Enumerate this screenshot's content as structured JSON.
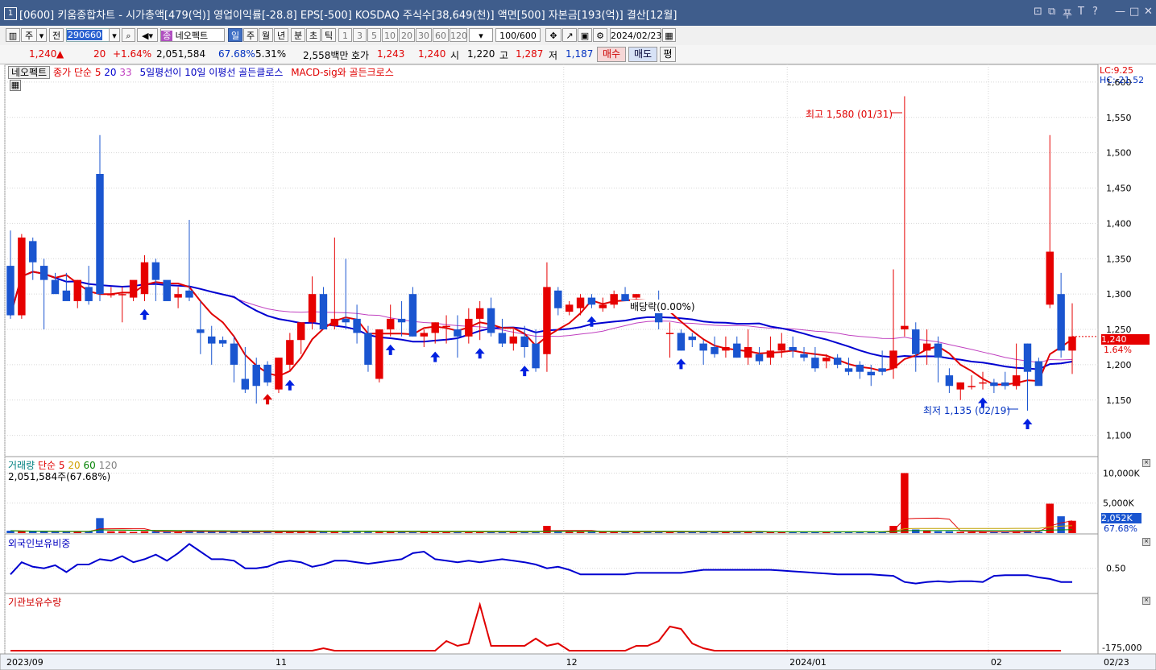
{
  "titlebar": {
    "app_number": "1",
    "title": "[0600] 키움종합차트 - 시가총액[479(억)] 영업이익률[-28.8] EPS[-500] KOSDAQ 주식수[38,649(천)] 액면[500] 자본금[193(억)] 결산[12월]",
    "controls": [
      "⊡",
      "⧉",
      "푸",
      "T",
      "?",
      "—",
      "□",
      "✕"
    ]
  },
  "toolbar": {
    "period_type": "주",
    "scope": "전",
    "code": "290660",
    "stock_name": "네오펙트",
    "stock_badge": "종",
    "periods": [
      "일",
      "주",
      "월",
      "년",
      "분",
      "초",
      "틱"
    ],
    "active_period": "일",
    "intervals": [
      "1",
      "3",
      "5",
      "10",
      "20",
      "30",
      "60",
      "120"
    ],
    "count": "100",
    "count_max": "/600",
    "date": "2024/02/23"
  },
  "quote": {
    "price": "1,240",
    "arrow": "▲",
    "change": "20",
    "change_pct": "+1.64%",
    "volume": "2,051,584",
    "volume_ratio": "67.68%",
    "turnover": "5.31%",
    "amount": "2,558백만",
    "bid_label": "호가",
    "ask": "1,243",
    "bid": "1,240",
    "open_label": "시",
    "open": "1,220",
    "high_label": "고",
    "high": "1,287",
    "low_label": "저",
    "low": "1,187",
    "buy_label": "매수",
    "sell_label": "매도",
    "avg_label": "평"
  },
  "legend": {
    "name_tag": "네오펙트",
    "ma_label": "종가 단순",
    "ma5": "5",
    "ma20": "20",
    "ma33": "33",
    "cross1": "5일평선이 10일 이평선 골든클로스",
    "cross2": "MACD-sig와 골든크로스",
    "lc": "LC:9.25",
    "hc": "HC:-21.52"
  },
  "annotations": {
    "high": "최고 1,580 (01/31)",
    "low": "최저 1,135 (02/19)",
    "dividend": "배당락(0.00%)",
    "current_price": "1,240",
    "current_pct": "1.64%"
  },
  "price_axis": [
    "1,600",
    "1,550",
    "1,500",
    "1,450",
    "1,400",
    "1,350",
    "1,300",
    "1,250",
    "1,200",
    "1,150",
    "1,100"
  ],
  "volume_panel": {
    "label": "거래량",
    "ma_label": "단순",
    "ma5": "5",
    "ma20": "20",
    "ma60": "60",
    "ma120": "120",
    "value_text": "2,051,584주(67.68%)",
    "axis": [
      "10,000K",
      "5,000K"
    ],
    "current": "2,052K",
    "current_pct": "67.68%"
  },
  "foreign_panel": {
    "label": "외국인보유비중",
    "axis": [
      "0.50"
    ]
  },
  "inst_panel": {
    "label": "기관보유수량",
    "axis": [
      "-175,000"
    ]
  },
  "x_axis": [
    "2023/09",
    "11",
    "12",
    "2024/01",
    "02",
    "02/23"
  ],
  "colors": {
    "up": "#e60000",
    "down": "#1a55d0",
    "ma5": "#e00000",
    "ma20": "#0000d0",
    "ma33": "#c040c0",
    "titlebar": "#3f5d8c"
  },
  "chart_data": {
    "type": "candlestick",
    "price_range": [
      1070,
      1625
    ],
    "candles": [
      [
        1340,
        1390,
        1265,
        1270
      ],
      [
        1270,
        1385,
        1265,
        1380
      ],
      [
        1375,
        1380,
        1320,
        1345
      ],
      [
        1340,
        1350,
        1250,
        1320
      ],
      [
        1320,
        1330,
        1305,
        1300
      ],
      [
        1305,
        1330,
        1300,
        1290
      ],
      [
        1290,
        1320,
        1280,
        1320
      ],
      [
        1310,
        1340,
        1285,
        1290
      ],
      [
        1470,
        1525,
        1290,
        1300
      ],
      [
        1300,
        1310,
        1295,
        1300
      ],
      [
        1300,
        1310,
        1260,
        1300
      ],
      [
        1295,
        1310,
        1290,
        1320
      ],
      [
        1300,
        1355,
        1290,
        1345
      ],
      [
        1345,
        1350,
        1290,
        1320
      ],
      [
        1320,
        1300,
        1295,
        1290
      ],
      [
        1295,
        1310,
        1280,
        1300
      ],
      [
        1305,
        1405,
        1290,
        1295
      ],
      [
        1250,
        1290,
        1215,
        1245
      ],
      [
        1240,
        1255,
        1200,
        1230
      ],
      [
        1235,
        1240,
        1225,
        1230
      ],
      [
        1230,
        1240,
        1175,
        1200
      ],
      [
        1180,
        1225,
        1160,
        1165
      ],
      [
        1200,
        1210,
        1145,
        1170
      ],
      [
        1200,
        1205,
        1170,
        1175
      ],
      [
        1165,
        1210,
        1160,
        1210
      ],
      [
        1200,
        1245,
        1190,
        1235
      ],
      [
        1235,
        1260,
        1215,
        1260
      ],
      [
        1260,
        1325,
        1250,
        1300
      ],
      [
        1300,
        1310,
        1250,
        1250
      ],
      [
        1255,
        1380,
        1250,
        1265
      ],
      [
        1265,
        1350,
        1250,
        1260
      ],
      [
        1265,
        1285,
        1230,
        1245
      ],
      [
        1245,
        1255,
        1190,
        1200
      ],
      [
        1180,
        1250,
        1175,
        1250
      ],
      [
        1250,
        1285,
        1240,
        1265
      ],
      [
        1265,
        1290,
        1240,
        1260
      ],
      [
        1300,
        1310,
        1240,
        1240
      ],
      [
        1240,
        1250,
        1225,
        1245
      ],
      [
        1245,
        1260,
        1230,
        1260
      ],
      [
        1255,
        1270,
        1230,
        1255
      ],
      [
        1250,
        1270,
        1210,
        1240
      ],
      [
        1240,
        1280,
        1230,
        1265
      ],
      [
        1265,
        1290,
        1235,
        1280
      ],
      [
        1280,
        1295,
        1240,
        1245
      ],
      [
        1245,
        1265,
        1225,
        1230
      ],
      [
        1230,
        1250,
        1220,
        1240
      ],
      [
        1240,
        1255,
        1210,
        1225
      ],
      [
        1230,
        1250,
        1190,
        1195
      ],
      [
        1215,
        1345,
        1190,
        1310
      ],
      [
        1305,
        1310,
        1270,
        1280
      ],
      [
        1275,
        1290,
        1270,
        1285
      ],
      [
        1280,
        1300,
        1270,
        1295
      ],
      [
        1295,
        1300,
        1280,
        1285
      ],
      [
        1280,
        1295,
        1275,
        1285
      ],
      [
        1285,
        1305,
        1280,
        1300
      ],
      [
        1300,
        1310,
        1290,
        1290
      ],
      [
        1295,
        1300,
        1280,
        1300
      ],
      [
        1285,
        1290,
        1280,
        1280
      ],
      [
        1285,
        1305,
        1250,
        1260
      ],
      [
        1245,
        1260,
        1210,
        1245
      ],
      [
        1245,
        1250,
        1220,
        1220
      ],
      [
        1240,
        1245,
        1225,
        1235
      ],
      [
        1230,
        1235,
        1200,
        1220
      ],
      [
        1225,
        1240,
        1210,
        1215
      ],
      [
        1220,
        1240,
        1210,
        1225
      ],
      [
        1230,
        1240,
        1210,
        1210
      ],
      [
        1210,
        1250,
        1200,
        1225
      ],
      [
        1215,
        1225,
        1200,
        1205
      ],
      [
        1210,
        1240,
        1200,
        1220
      ],
      [
        1220,
        1245,
        1210,
        1230
      ],
      [
        1225,
        1240,
        1210,
        1220
      ],
      [
        1215,
        1225,
        1205,
        1210
      ],
      [
        1210,
        1225,
        1190,
        1195
      ],
      [
        1205,
        1215,
        1195,
        1210
      ],
      [
        1210,
        1215,
        1195,
        1200
      ],
      [
        1195,
        1210,
        1185,
        1190
      ],
      [
        1200,
        1205,
        1180,
        1190
      ],
      [
        1190,
        1200,
        1170,
        1185
      ],
      [
        1195,
        1220,
        1185,
        1190
      ],
      [
        1195,
        1335,
        1180,
        1220
      ],
      [
        1250,
        1580,
        1240,
        1255
      ],
      [
        1250,
        1260,
        1190,
        1215
      ],
      [
        1220,
        1250,
        1200,
        1230
      ],
      [
        1230,
        1240,
        1175,
        1210
      ],
      [
        1185,
        1195,
        1160,
        1170
      ],
      [
        1165,
        1175,
        1150,
        1175
      ],
      [
        1170,
        1185,
        1165,
        1170
      ],
      [
        1175,
        1190,
        1165,
        1175
      ],
      [
        1175,
        1180,
        1160,
        1170
      ],
      [
        1175,
        1190,
        1165,
        1170
      ],
      [
        1170,
        1230,
        1165,
        1185
      ],
      [
        1230,
        1230,
        1135,
        1190
      ],
      [
        1205,
        1210,
        1175,
        1170
      ],
      [
        1285,
        1525,
        1280,
        1360
      ],
      [
        1300,
        1330,
        1210,
        1220
      ],
      [
        1220,
        1287,
        1187,
        1240
      ]
    ],
    "volumes_k": [
      400,
      300,
      300,
      300,
      200,
      200,
      300,
      300,
      2500,
      300,
      300,
      200,
      300,
      300,
      200,
      200,
      400,
      300,
      200,
      200,
      200,
      300,
      200,
      200,
      200,
      200,
      300,
      300,
      300,
      200,
      400,
      300,
      200,
      200,
      200,
      200,
      200,
      200,
      200,
      200,
      200,
      200,
      200,
      200,
      200,
      200,
      200,
      200,
      1200,
      300,
      300,
      200,
      200,
      200,
      200,
      200,
      200,
      200,
      200,
      200,
      200,
      200,
      200,
      200,
      200,
      200,
      200,
      200,
      200,
      200,
      200,
      200,
      200,
      200,
      200,
      200,
      200,
      200,
      200,
      1200,
      10000,
      600,
      400,
      300,
      300,
      200,
      200,
      200,
      200,
      200,
      300,
      300,
      200,
      4900,
      2800,
      2052
    ],
    "foreign_ratio": [
      0.42,
      0.58,
      0.52,
      0.5,
      0.54,
      0.45,
      0.55,
      0.55,
      0.62,
      0.6,
      0.66,
      0.58,
      0.62,
      0.68,
      0.6,
      0.7,
      0.82,
      0.72,
      0.62,
      0.62,
      0.6,
      0.5,
      0.5,
      0.52,
      0.58,
      0.6,
      0.58,
      0.52,
      0.55,
      0.6,
      0.6,
      0.58,
      0.56,
      0.58,
      0.6,
      0.62,
      0.7,
      0.72,
      0.62,
      0.6,
      0.58,
      0.6,
      0.58,
      0.6,
      0.62,
      0.6,
      0.58,
      0.55,
      0.5,
      0.52,
      0.48,
      0.42,
      0.42,
      0.42,
      0.42,
      0.42,
      0.44,
      0.44,
      0.44,
      0.44,
      0.44,
      0.46,
      0.48,
      0.48,
      0.48,
      0.48,
      0.48,
      0.48,
      0.48,
      0.47,
      0.46,
      0.45,
      0.44,
      0.43,
      0.42,
      0.42,
      0.42,
      0.42,
      0.41,
      0.4,
      0.32,
      0.3,
      0.32,
      0.33,
      0.32,
      0.33,
      0.33,
      0.32,
      0.4,
      0.41,
      0.41,
      0.41,
      0.38,
      0.36,
      0.32,
      0.32
    ]
  }
}
